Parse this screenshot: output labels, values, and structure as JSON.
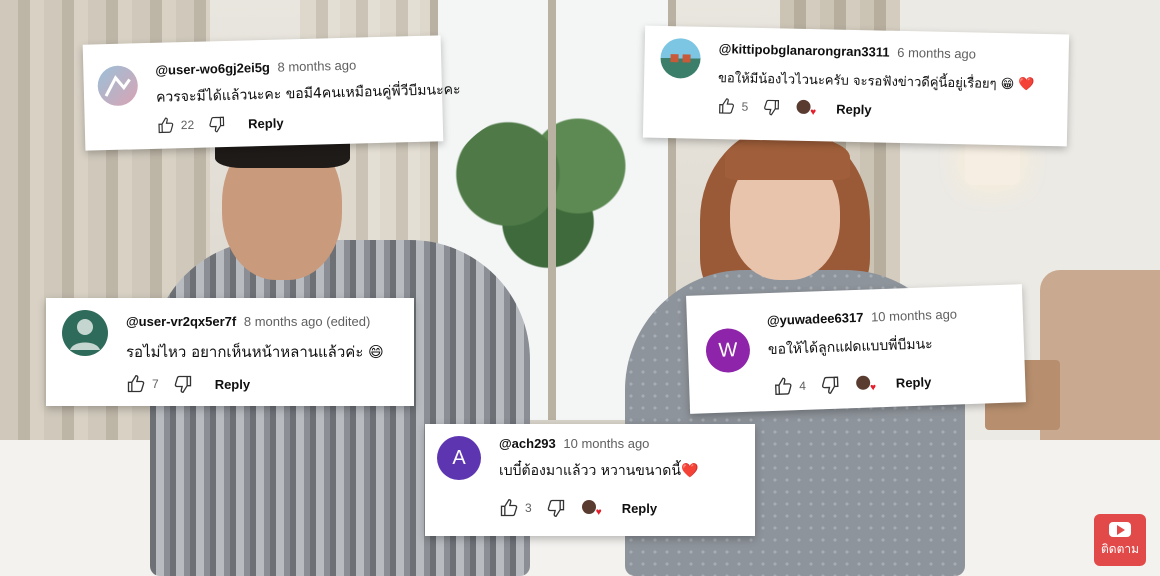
{
  "comments": [
    {
      "handle": "@user-wo6gj2ei5g",
      "time": "8 months ago",
      "text": "ควรจะมีได้แล้วนะคะ ขอมี4คนเหมือนคู่พี่วีบีมนะคะ",
      "likes": "22",
      "reply": "Reply",
      "avatar": "sketch-avatar"
    },
    {
      "handle": "@kittipobglanarongran3311",
      "time": "6 months ago",
      "text": "ขอให้มีน้องไวไวนะครับ จะรอฟังข่าวดีคู่นี้อยู่เรื่อยๆ 😁 ❤️",
      "likes": "5",
      "reply": "Reply",
      "avatar": "landscape-avatar"
    },
    {
      "handle": "@user-vr2qx5er7f",
      "time": "8 months ago (edited)",
      "text": "รอไม่ไหว อยากเห็นหน้าหลานแล้วค่ะ 😄",
      "likes": "7",
      "reply": "Reply",
      "avatar": "default-avatar"
    },
    {
      "handle": "@yuwadee6317",
      "time": "10 months ago",
      "text": "ขอให้ได้ลูกแฝดแบบพี่บีมนะ",
      "likes": "4",
      "reply": "Reply",
      "avatar_letter": "W",
      "avatar_color": "#8e24aa"
    },
    {
      "handle": "@ach293",
      "time": "10 months ago",
      "text": "เบบี๋ต้องมาแล้วว หวานขนาดนี้❤️",
      "likes": "3",
      "reply": "Reply",
      "avatar_letter": "A",
      "avatar_color": "#5e35b1"
    }
  ],
  "watermark": {
    "label": "ติดตาม",
    "icon": "play-icon",
    "color": "#e24a4a"
  }
}
